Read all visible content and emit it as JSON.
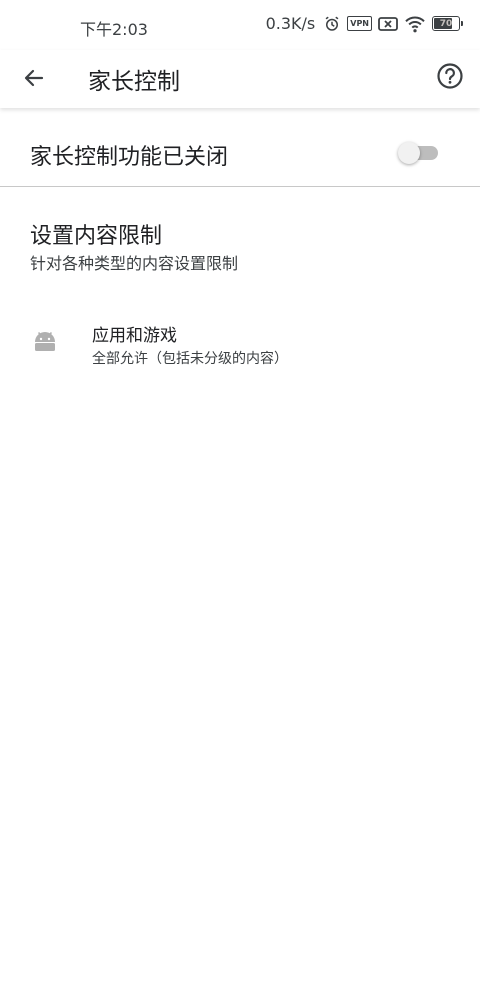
{
  "status_bar": {
    "time": "下午2:03",
    "net_speed": "0.3K/s",
    "vpn_label": "VPN",
    "battery": "70"
  },
  "app_bar": {
    "title": "家长控制",
    "back_icon": "arrow-back-icon",
    "help_icon": "help-circle-icon"
  },
  "master_switch": {
    "label": "家长控制功能已关闭",
    "enabled": false
  },
  "restrictions": {
    "title": "设置内容限制",
    "subtitle": "针对各种类型的内容设置限制",
    "items": [
      {
        "icon": "android-icon",
        "title": "应用和游戏",
        "subtitle": "全部允许（包括未分级的内容）"
      }
    ]
  },
  "colors": {
    "text_primary": "#202124",
    "text_secondary": "#3c4043",
    "icon_gray": "#b0b0b0",
    "switch_track": "#bdbdbd",
    "switch_thumb": "#f1f1f1"
  }
}
